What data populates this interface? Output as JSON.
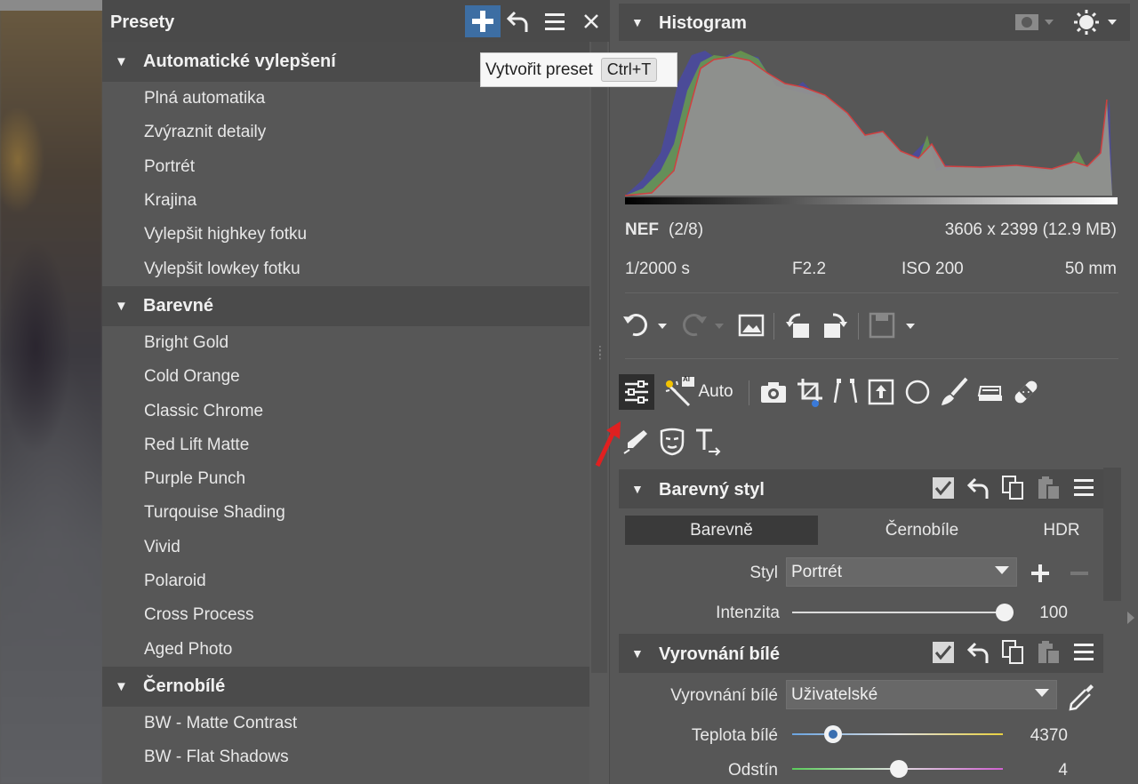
{
  "presets_panel": {
    "title": "Presety",
    "tooltip": {
      "text": "Vytvořit preset",
      "shortcut": "Ctrl+T"
    },
    "categories": [
      {
        "name": "Automatické vylepšení",
        "items": [
          "Plná automatika",
          "Zvýraznit detaily",
          "Portrét",
          "Krajina",
          "Vylepšit highkey fotku",
          "Vylepšit lowkey fotku"
        ]
      },
      {
        "name": "Barevné",
        "items": [
          "Bright Gold",
          "Cold Orange",
          "Classic Chrome",
          "Red Lift Matte",
          "Purple Punch",
          "Turqouise Shading",
          "Vivid",
          "Polaroid",
          "Cross Process",
          "Aged Photo"
        ]
      },
      {
        "name": "Černobílé",
        "items": [
          "BW - Matte Contrast",
          "BW - Flat Shadows"
        ]
      }
    ]
  },
  "histogram": {
    "title": "Histogram",
    "format": "NEF",
    "index": "(2/8)",
    "dimensions": "3606 x 2399 (12.9 MB)",
    "shutter": "1/2000 s",
    "aperture": "F2.2",
    "iso": "ISO 200",
    "focal": "50 mm"
  },
  "tools": {
    "auto_label": "Auto",
    "ai_badge": "AI"
  },
  "color_style": {
    "title": "Barevný styl",
    "tabs": [
      "Barevně",
      "Černobíle",
      "HDR"
    ],
    "active_tab": "Barevně",
    "style_label": "Styl",
    "style_value": "Portrét",
    "intensity_label": "Intenzita",
    "intensity_value": "100"
  },
  "white_balance": {
    "title": "Vyrovnání bílé",
    "wb_label": "Vyrovnání bílé",
    "wb_value": "Uživatelské",
    "temp_label": "Teplota bílé",
    "temp_value": "4370",
    "tint_label": "Odstín",
    "tint_value": "4"
  },
  "colors": {
    "accent": "#3d6ea3",
    "panel": "#575757",
    "header": "#4b4b4b",
    "arrow": "#e02020"
  }
}
